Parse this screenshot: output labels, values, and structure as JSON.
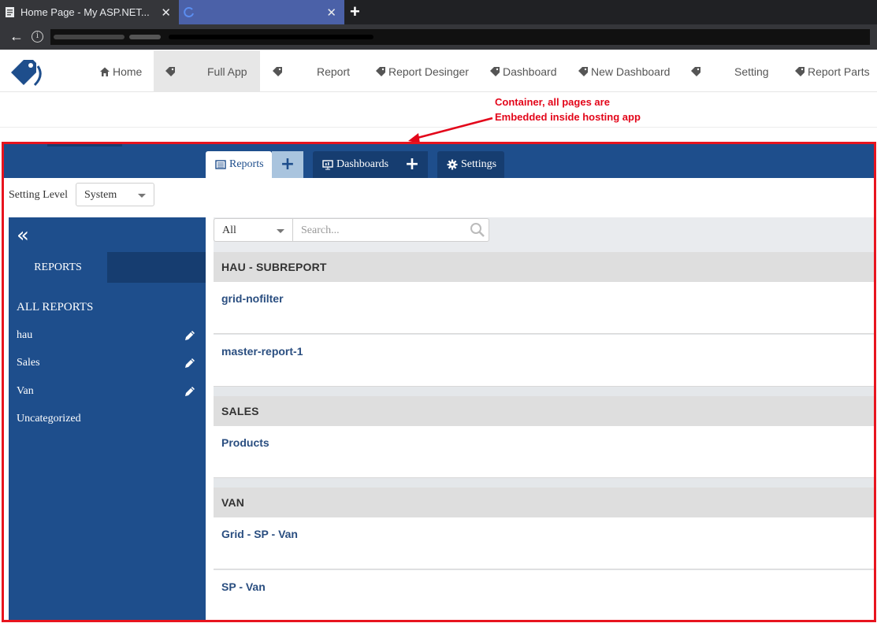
{
  "browser": {
    "tabs": [
      {
        "title": "Home Page - My ASP.NET...",
        "close": "✕"
      },
      {
        "title": "",
        "close": "✕"
      }
    ],
    "new_tab": "+",
    "back": "←",
    "info": "i"
  },
  "host_nav": {
    "items": [
      {
        "label": "Home",
        "icon": "home-icon"
      },
      {
        "label": "Full App",
        "icon": "tag-icon",
        "active": true
      },
      {
        "label": "Report",
        "icon": "tag-icon"
      },
      {
        "label": "Report Desinger",
        "icon": "tag-icon"
      },
      {
        "label": "Dashboard",
        "icon": "tag-icon"
      },
      {
        "label": "New Dashboard",
        "icon": "tag-icon"
      },
      {
        "label": "Setting",
        "icon": "tag-icon"
      },
      {
        "label": "Report Parts",
        "icon": "tag-icon"
      }
    ]
  },
  "annotation": {
    "line1": "Container, all pages are",
    "line2": "Embedded inside hosting app",
    "color": "#e3061a"
  },
  "tabs": {
    "reports": "Reports",
    "dashboards": "Dashboards",
    "settings": "Settings",
    "add": "+"
  },
  "setting": {
    "label": "Setting Level",
    "value": "System"
  },
  "sidebar": {
    "collapse": "«",
    "tab": "REPORTS",
    "all": "ALL REPORTS",
    "categories": [
      {
        "label": "hau",
        "editable": true
      },
      {
        "label": "Sales",
        "editable": true
      },
      {
        "label": "Van",
        "editable": true
      },
      {
        "label": "Uncategorized",
        "editable": false
      }
    ]
  },
  "filter": {
    "category": "All",
    "search_placeholder": "Search..."
  },
  "groups": [
    {
      "name": "HAU - SUBREPORT",
      "reports": [
        "grid-nofilter",
        "master-report-1"
      ]
    },
    {
      "name": "SALES",
      "reports": [
        "Products"
      ]
    },
    {
      "name": "VAN",
      "reports": [
        "Grid - SP - Van",
        "SP - Van"
      ]
    }
  ],
  "colors": {
    "primary": "#1e4e8c",
    "primary_dark": "#163d70",
    "frame": "#e8141e",
    "link": "#2a4e80"
  }
}
